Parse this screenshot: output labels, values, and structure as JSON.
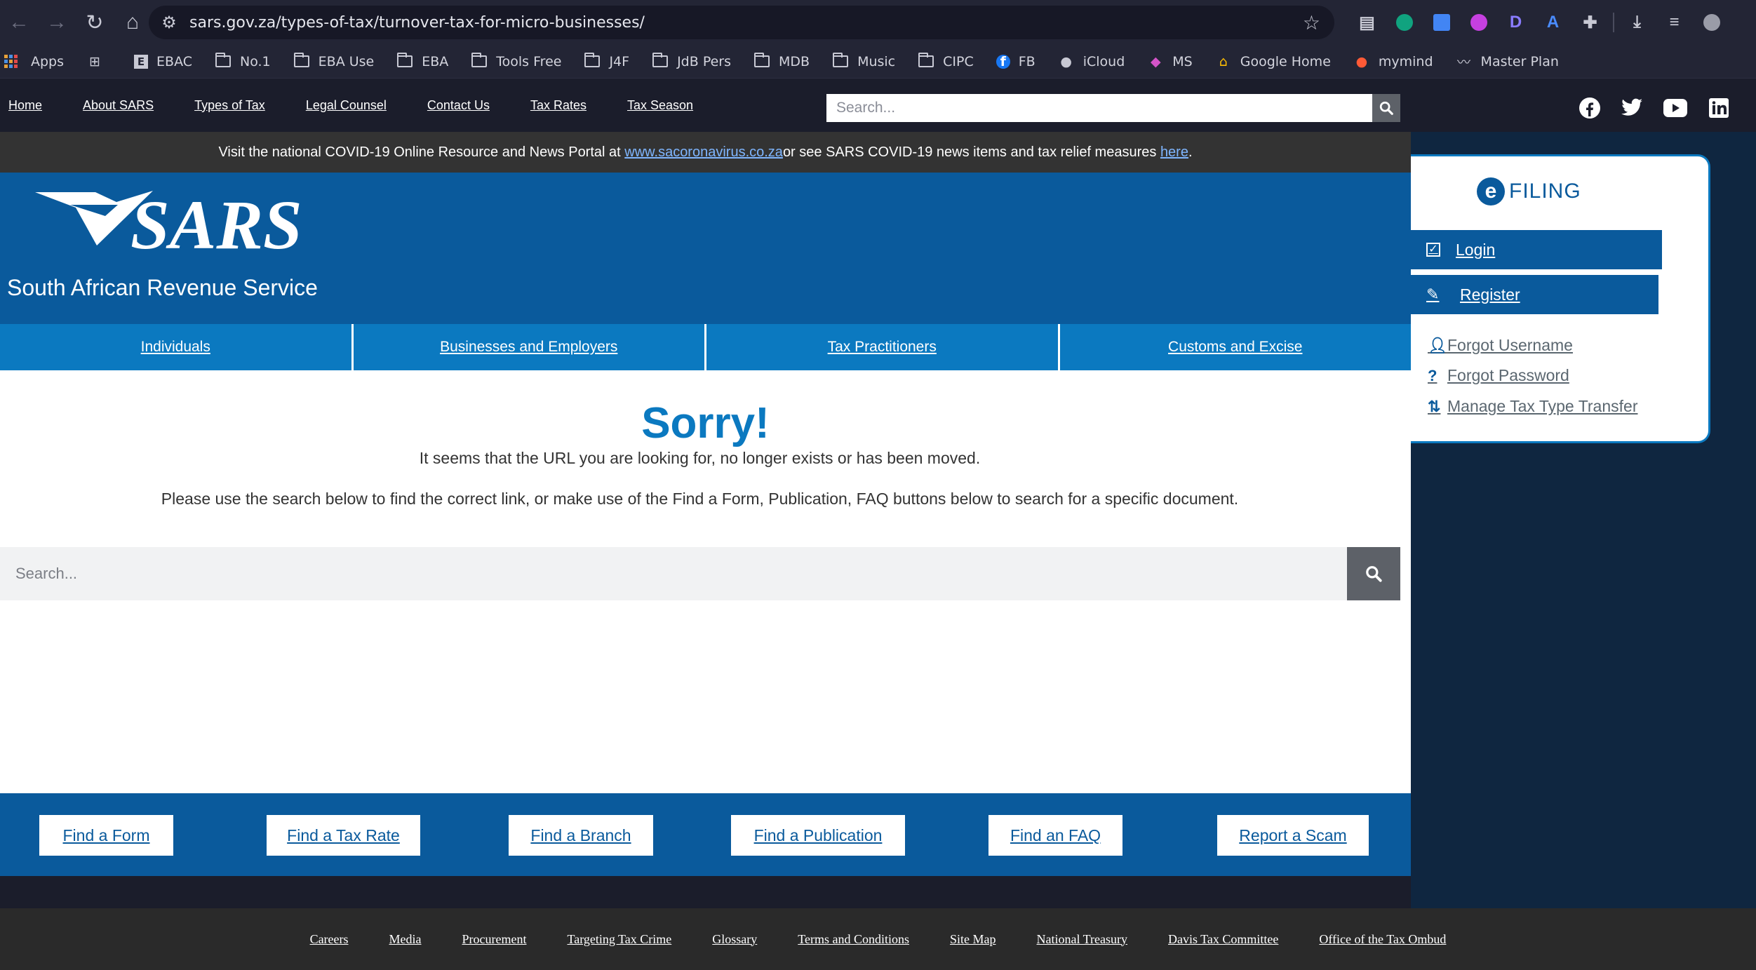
{
  "browser": {
    "url": "sars.gov.za/types-of-tax/turnover-tax-for-micro-businesses/",
    "bookmarks": [
      {
        "label": "Apps",
        "icon": "apps-grid-icon"
      },
      {
        "label": "",
        "icon": "grid-icon"
      },
      {
        "label": "EBAC",
        "icon": "ebac-icon"
      },
      {
        "label": "No.1",
        "icon": "folder-icon"
      },
      {
        "label": "EBA Use",
        "icon": "folder-icon"
      },
      {
        "label": "EBA",
        "icon": "folder-icon"
      },
      {
        "label": "Tools Free",
        "icon": "folder-icon"
      },
      {
        "label": "J4F",
        "icon": "folder-icon"
      },
      {
        "label": "JdB Pers",
        "icon": "folder-icon"
      },
      {
        "label": "MDB",
        "icon": "folder-icon"
      },
      {
        "label": "Music",
        "icon": "folder-icon"
      },
      {
        "label": "CIPC",
        "icon": "folder-icon"
      },
      {
        "label": "FB",
        "icon": "facebook-icon"
      },
      {
        "label": "iCloud",
        "icon": "apple-icon"
      },
      {
        "label": "MS",
        "icon": "microsoft-icon"
      },
      {
        "label": "Google Home",
        "icon": "google-home-icon"
      },
      {
        "label": "mymind",
        "icon": "mymind-icon"
      },
      {
        "label": "Master Plan",
        "icon": "master-plan-icon"
      }
    ]
  },
  "topnav": {
    "links": [
      "Home",
      "About SARS",
      "Types of Tax",
      "Legal Counsel",
      "Contact Us",
      "Tax Rates",
      "Tax Season"
    ],
    "search_placeholder": "Search..."
  },
  "covid": {
    "text_before": "Visit the national COVID-19 Online Resource and News Portal at ",
    "link1": "www.sacoronavirus.co.za",
    "text_middle": " or see SARS COVID-19 news items and tax relief measures ",
    "link2": "here",
    "text_after": "."
  },
  "brand": {
    "logo_text": "SARS",
    "subtitle": "South African Revenue Service"
  },
  "categories": [
    "Individuals",
    "Businesses and Employers",
    "Tax Practitioners",
    "Customs and Excise"
  ],
  "error": {
    "title": "Sorry!",
    "message1": "It seems that the URL you are looking for, no longer exists or has been moved.",
    "message2": "Please use the search below to find the correct link, or make use of the Find a Form, Publication, FAQ buttons below to search for a specific document.",
    "search_placeholder": "Search..."
  },
  "finders": [
    "Find a Form",
    "Find a Tax Rate",
    "Find a Branch",
    "Find a Publication",
    "Find an FAQ",
    "Report a Scam"
  ],
  "efiling": {
    "logo_letter": "e",
    "logo_text": "FILING",
    "login": "Login",
    "register": "Register",
    "forgot_username": "Forgot Username",
    "forgot_password": "Forgot Password",
    "manage_transfer": "Manage Tax Type Transfer"
  },
  "footer": {
    "links": [
      "Careers",
      "Media",
      "Procurement",
      "Targeting Tax Crime",
      "Glossary",
      "Terms and Conditions",
      "Site Map",
      "National Treasury",
      "Davis Tax Committee",
      "Office of the Tax Ombud"
    ]
  },
  "colors": {
    "sars_blue": "#0a5a9c",
    "category_blue": "#0b79c0",
    "dark_bg": "#1b1d2b",
    "covid_bar": "#333333"
  }
}
